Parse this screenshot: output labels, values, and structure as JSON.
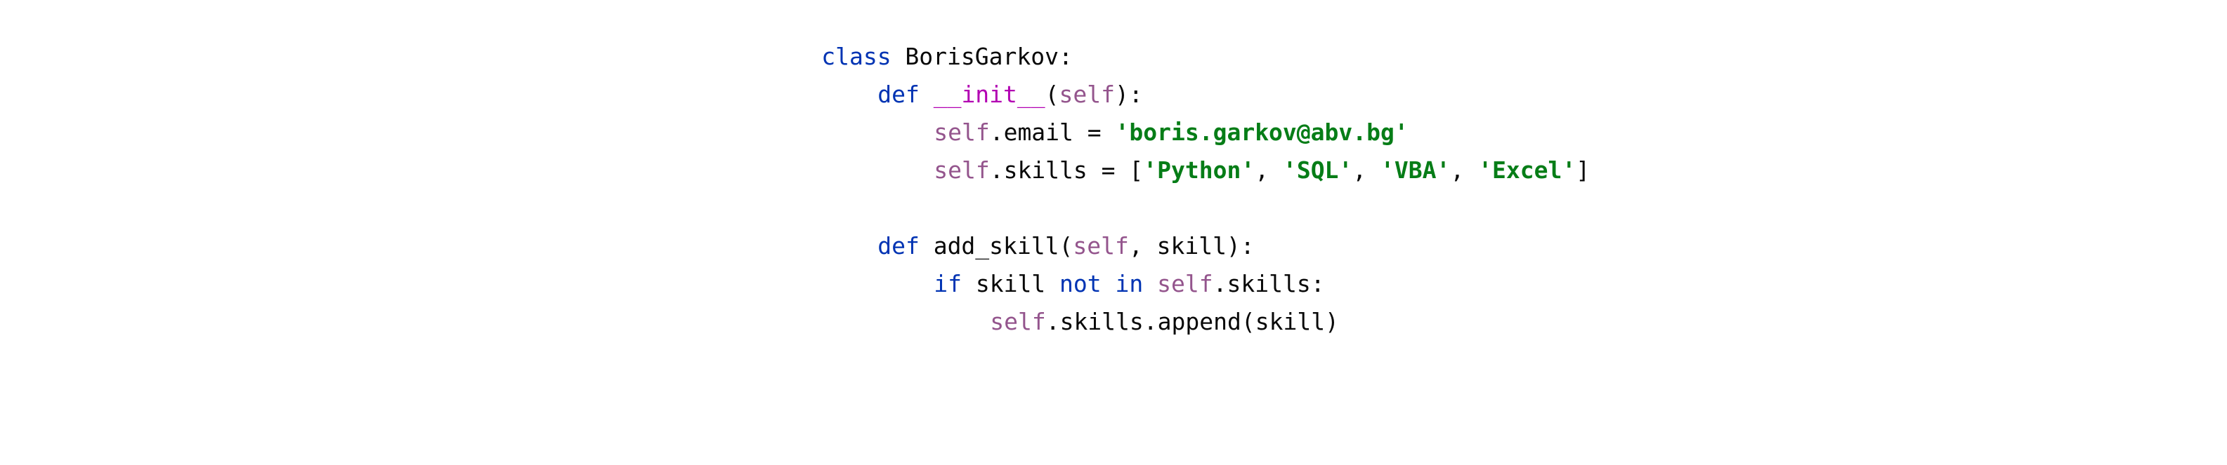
{
  "code": {
    "line1": {
      "kw": "class",
      "name": " BorisGarkov:"
    },
    "line2": {
      "kw": "def",
      "sp": " ",
      "fn": "__init__",
      "open": "(",
      "self": "self",
      "close": "):"
    },
    "line3": {
      "self": "self",
      "rest": ".email = ",
      "str": "'boris.garkov@abv.bg'"
    },
    "line4": {
      "self": "self",
      "rest": ".skills = [",
      "s1": "'Python'",
      "c1": ", ",
      "s2": "'SQL'",
      "c2": ", ",
      "s3": "'VBA'",
      "c3": ", ",
      "s4": "'Excel'",
      "end": "]"
    },
    "line6": {
      "kw": "def",
      "fn": " add_skill(",
      "self": "self",
      "rest": ", skill):"
    },
    "line7": {
      "kw1": "if",
      "mid1": " skill ",
      "kw2": "not",
      "sp": " ",
      "kw3": "in",
      "sp2": " ",
      "self": "self",
      "rest": ".skills:"
    },
    "line8": {
      "self": "self",
      "rest": ".skills.append(skill)"
    }
  },
  "colors": {
    "keyword": "#0033b3",
    "self": "#94558d",
    "dunder": "#b200b2",
    "string": "#067d17",
    "text": "#080808",
    "background": "#ffffff"
  }
}
